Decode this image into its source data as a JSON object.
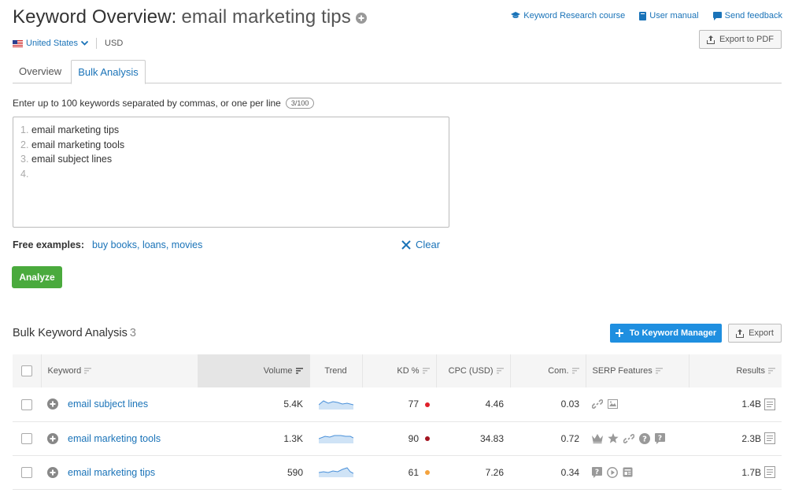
{
  "header": {
    "title_prefix": "Keyword Overview:",
    "keyword": "email marketing tips",
    "links": {
      "course": "Keyword Research course",
      "manual": "User manual",
      "feedback": "Send feedback"
    },
    "export_pdf": "Export to PDF",
    "database": "United States",
    "currency": "USD"
  },
  "tabs": [
    "Overview",
    "Bulk Analysis"
  ],
  "input": {
    "instruction": "Enter up to 100 keywords separated by commas, or one per line",
    "counter": "3/100",
    "lines": [
      {
        "num": "1.",
        "text": "email marketing tips"
      },
      {
        "num": "2.",
        "text": "email marketing tools"
      },
      {
        "num": "3.",
        "text": "email subject lines"
      },
      {
        "num": "4.",
        "text": ""
      }
    ],
    "examples_label": "Free examples:",
    "examples": "buy books, loans, movies",
    "clear": "Clear",
    "analyze": "Analyze"
  },
  "results": {
    "title": "Bulk Keyword Analysis",
    "count": "3",
    "keyword_manager_btn": "To Keyword Manager",
    "export_btn": "Export",
    "columns": {
      "keyword": "Keyword",
      "volume": "Volume",
      "trend": "Trend",
      "kd": "KD %",
      "cpc": "CPC (USD)",
      "com": "Com.",
      "serp": "SERP Features",
      "results": "Results"
    },
    "rows": [
      {
        "keyword": "email subject lines",
        "volume": "5.4K",
        "kd": "77",
        "kd_color": "#e0202a",
        "cpc": "4.46",
        "com": "0.03",
        "serp_icons": [
          "link-icon",
          "image-icon"
        ],
        "results": "1.4B"
      },
      {
        "keyword": "email marketing tools",
        "volume": "1.3K",
        "kd": "90",
        "kd_color": "#a31420",
        "cpc": "34.83",
        "com": "0.72",
        "serp_icons": [
          "crown-icon",
          "star-icon",
          "link-icon",
          "question-icon",
          "faq-icon"
        ],
        "results": "2.3B"
      },
      {
        "keyword": "email marketing tips",
        "volume": "590",
        "kd": "61",
        "kd_color": "#f4a33d",
        "cpc": "7.26",
        "com": "0.34",
        "serp_icons": [
          "faq-icon",
          "video-icon",
          "news-icon"
        ],
        "results": "1.7B"
      }
    ]
  }
}
